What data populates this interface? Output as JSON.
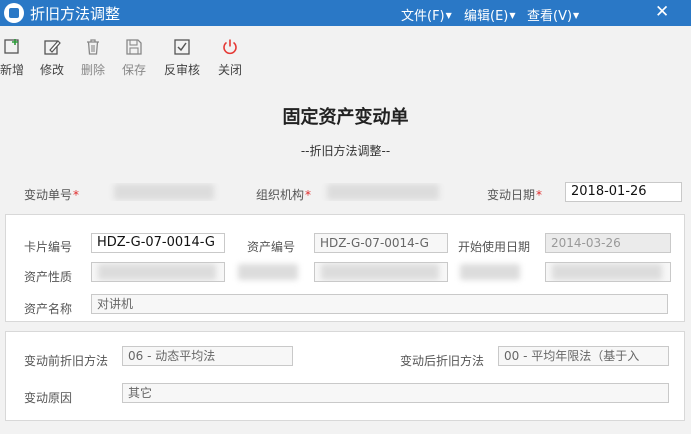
{
  "window": {
    "title": "折旧方法调整",
    "close_glyph": "✕"
  },
  "menus": [
    {
      "label": "文件(F)"
    },
    {
      "label": "编辑(E)"
    },
    {
      "label": "查看(V)"
    }
  ],
  "toolbar": {
    "items": [
      {
        "label": "新增",
        "icon": "add-icon"
      },
      {
        "label": "修改",
        "icon": "edit-icon"
      },
      {
        "label": "删除",
        "icon": "delete-icon"
      },
      {
        "label": "保存",
        "icon": "save-icon"
      },
      {
        "label": "反审核",
        "icon": "unapprove-icon"
      },
      {
        "label": "关闭",
        "icon": "power-icon"
      }
    ],
    "power_color": "#e53935"
  },
  "form": {
    "title": "固定资产变动单",
    "subtitle": "--折旧方法调整--"
  },
  "header_fields": {
    "change_no_label": "变动单号",
    "org_label": "组织机构",
    "change_date_label": "变动日期",
    "change_date_value": "2018-01-26",
    "required_mark": "*"
  },
  "asset_section": {
    "card_no_label": "卡片编号",
    "card_no_value": "HDZ-G-07-0014-G",
    "asset_no_label": "资产编号",
    "asset_no_value": "HDZ-G-07-0014-G",
    "start_date_label": "开始使用日期",
    "start_date_value": "2014-03-26",
    "asset_nature_label": "资产性质",
    "asset_name_label": "资产名称",
    "asset_name_value": "对讲机"
  },
  "change_section": {
    "before_label": "变动前折旧方法",
    "before_value": "06 - 动态平均法",
    "after_label": "变动后折旧方法",
    "after_value": "00 - 平均年限法（基于入",
    "reason_label": "变动原因",
    "reason_value": "其它"
  },
  "colors": {
    "titlebar": "#2a78c6",
    "required": "#e02b2b"
  }
}
